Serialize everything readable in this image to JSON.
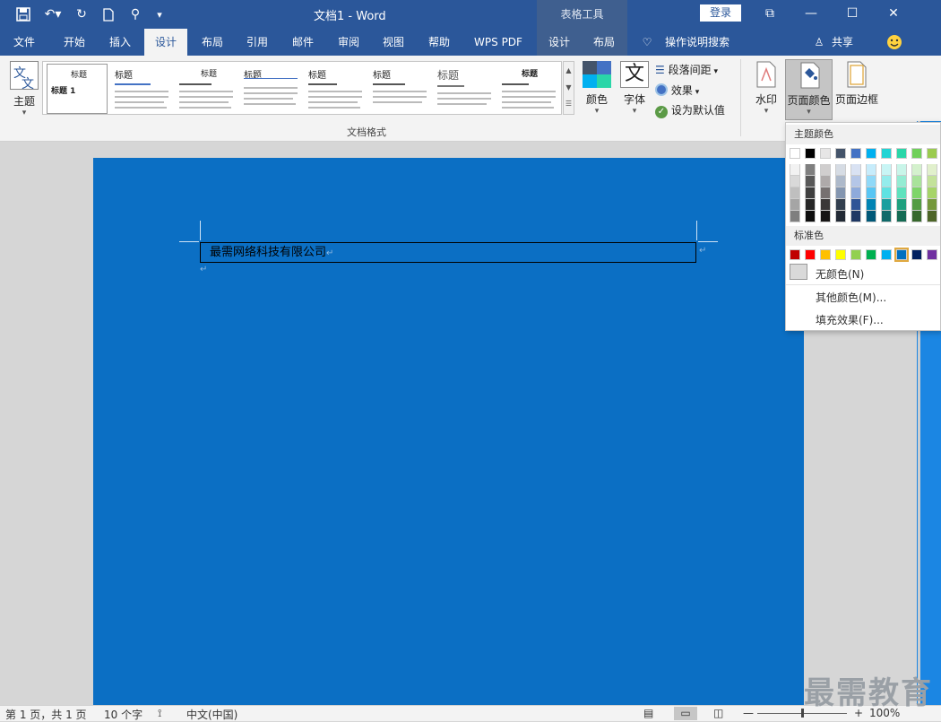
{
  "titlebar": {
    "title": "文档1 - Word",
    "table_tools": "表格工具",
    "login": "登录"
  },
  "tabs": [
    {
      "label": "文件"
    },
    {
      "label": "开始"
    },
    {
      "label": "插入"
    },
    {
      "label": "设计"
    },
    {
      "label": "布局"
    },
    {
      "label": "引用"
    },
    {
      "label": "邮件"
    },
    {
      "label": "审阅"
    },
    {
      "label": "视图"
    },
    {
      "label": "帮助"
    },
    {
      "label": "WPS PDF"
    },
    {
      "label": "设计"
    },
    {
      "label": "布局"
    }
  ],
  "tell_me": "操作说明搜索",
  "share": "共享",
  "ribbon": {
    "theme": "主题",
    "gallery_titles": [
      "标题",
      "标题",
      "标题",
      "标题",
      "标题",
      "标题",
      "标题",
      "标题"
    ],
    "gallery_first_heading": "标题 1",
    "group_label": "文档格式",
    "colors": "颜色",
    "fonts": "字体",
    "fonts_glyph": "文",
    "paragraph_spacing": "段落间距",
    "effects": "效果",
    "set_default": "设为默认值",
    "watermark": "水印",
    "page_color": "页面颜色",
    "page_border": "页面边框"
  },
  "dropdown": {
    "theme_colors": "主题颜色",
    "standard_colors": "标准色",
    "no_color": "无颜色(N)",
    "more_colors": "其他颜色(M)...",
    "fill_effects": "填充效果(F)...",
    "theme_rows": [
      [
        "#ffffff",
        "#000000",
        "#e7e6e6",
        "#44546a",
        "#4472c4",
        "#00b0f0",
        "#21d4d4",
        "#2ad6a8",
        "#70d05a",
        "#9bcb4f"
      ],
      [
        "#f2f2f2",
        "#7f7f7f",
        "#d0cece",
        "#d6dce4",
        "#d9e2f3",
        "#c7ecfb",
        "#c8f5f5",
        "#c9f5e9",
        "#d4f1cd",
        "#e1f0cc"
      ],
      [
        "#d9d9d9",
        "#595959",
        "#aeaaaa",
        "#adb9ca",
        "#b4c6e7",
        "#90d9f8",
        "#94ecec",
        "#94ecd3",
        "#a9e39b",
        "#c3e29a"
      ],
      [
        "#bfbfbf",
        "#3f3f3f",
        "#767171",
        "#8496b0",
        "#8eaadb",
        "#59c6f4",
        "#5fe2e2",
        "#5fe2bd",
        "#7ed569",
        "#a6d468"
      ],
      [
        "#a5a5a5",
        "#262626",
        "#3a3838",
        "#323f4f",
        "#2f5496",
        "#0084b4",
        "#199f9f",
        "#1fa07e",
        "#539c43",
        "#74983b"
      ],
      [
        "#7f7f7f",
        "#0d0d0d",
        "#171616",
        "#222a35",
        "#1f3864",
        "#005878",
        "#106a6a",
        "#156b54",
        "#37682d",
        "#4d6527"
      ]
    ],
    "standard": [
      "#c00000",
      "#ff0000",
      "#ffc000",
      "#ffff00",
      "#92d050",
      "#00b050",
      "#00b0f0",
      "#0070c0",
      "#002060",
      "#7030a0"
    ]
  },
  "document": {
    "cell_text": "最需网络科技有限公司",
    "page_color": "#0b6fc4"
  },
  "status": {
    "page": "第 1 页，共 1 页",
    "words": "10 个字",
    "language": "中文(中国)",
    "zoom": "100%",
    "zoom_fraction": 0.5
  },
  "watermark_text": "最需教育"
}
